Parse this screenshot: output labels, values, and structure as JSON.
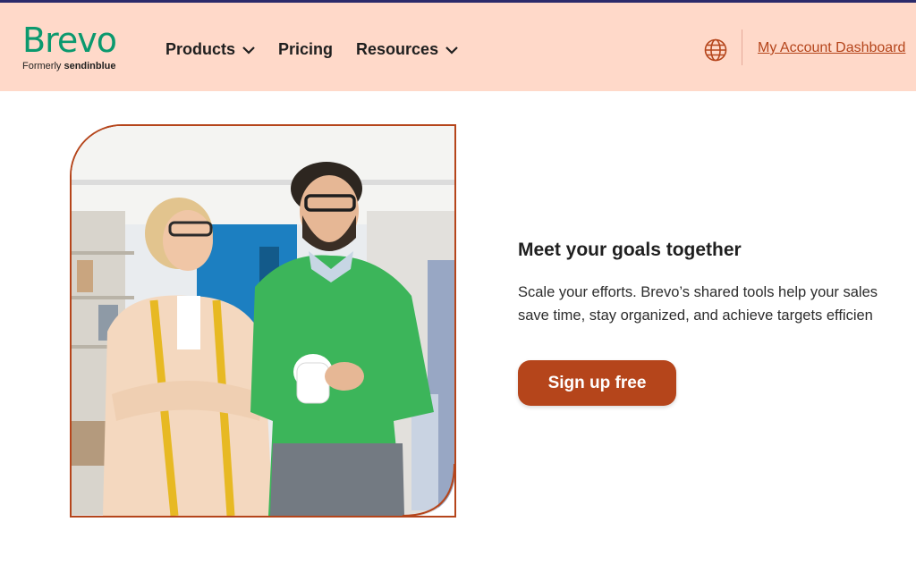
{
  "brand": {
    "name": "Brevo",
    "formerly_prefix": "Formerly",
    "formerly_name": "sendinblue",
    "color": "#0b996e"
  },
  "nav": {
    "items": [
      {
        "label": "Products",
        "has_dropdown": true
      },
      {
        "label": "Pricing",
        "has_dropdown": false
      },
      {
        "label": "Resources",
        "has_dropdown": true
      }
    ]
  },
  "header": {
    "background": "#ffd9c9",
    "globe_icon": "globe-icon",
    "account_link": "My Account Dashboard"
  },
  "hero": {
    "heading": "Meet your goals together",
    "description_line1": "Scale your efforts. Brevo’s shared tools help your sales",
    "description_line2": "save time, stay organized, and achieve targets efficien",
    "cta_label": "Sign up free",
    "accent": "#b5451b"
  }
}
